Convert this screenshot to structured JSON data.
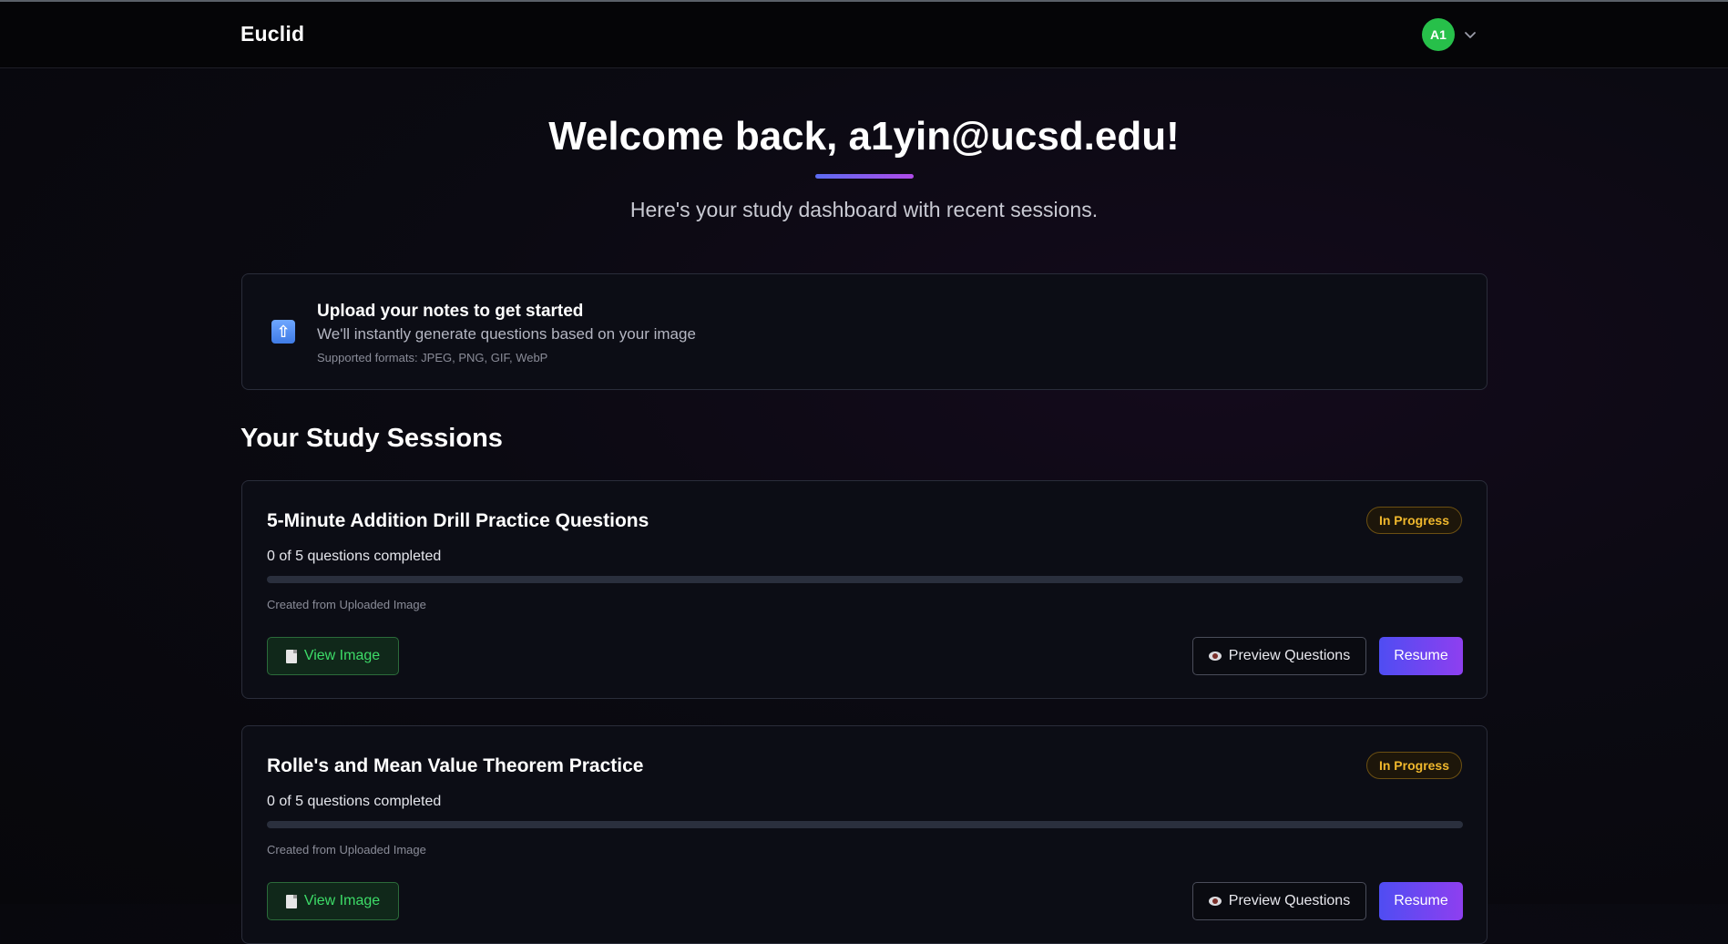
{
  "header": {
    "brand": "Euclid",
    "avatar_initials": "A1"
  },
  "hero": {
    "welcome": "Welcome back, a1yin@ucsd.edu!",
    "subtitle": "Here's your study dashboard with recent sessions."
  },
  "upload": {
    "icon": "upload-arrow-icon",
    "title": "Upload your notes to get started",
    "description": "We'll instantly generate questions based on your image",
    "formats": "Supported formats: JPEG, PNG, GIF, WebP"
  },
  "sessions": {
    "heading": "Your Study Sessions",
    "items": [
      {
        "title": "5-Minute Addition Drill Practice Questions",
        "status": "In Progress",
        "progress_text": "0 of 5 questions completed",
        "progress_fraction": 0,
        "created": "Created from Uploaded Image",
        "view_label": "View Image",
        "preview_label": "Preview Questions",
        "resume_label": "Resume"
      },
      {
        "title": "Rolle's and Mean Value Theorem Practice",
        "status": "In Progress",
        "progress_text": "0 of 5 questions completed",
        "progress_fraction": 0,
        "created": "Created from Uploaded Image",
        "view_label": "View Image",
        "preview_label": "Preview Questions",
        "resume_label": "Resume"
      }
    ]
  },
  "colors": {
    "accent_start": "#5b6cf2",
    "accent_end": "#b04be8",
    "avatar": "#27c04a",
    "status_badge": "#f0b82d",
    "view_button": "#3ddc68"
  }
}
